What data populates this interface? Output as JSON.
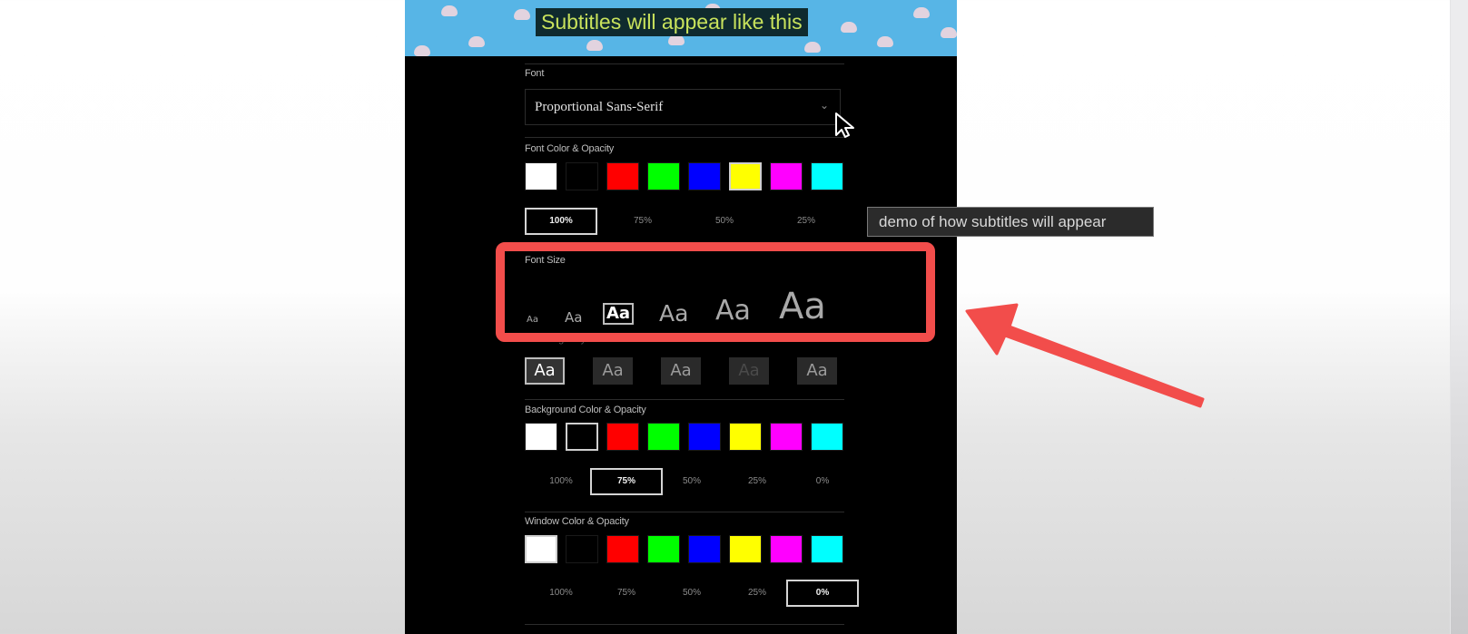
{
  "preview": {
    "subtitle_text": "Subtitles will appear like this",
    "background": "sky-with-clouds"
  },
  "font": {
    "label": "Font",
    "selected": "Proportional Sans-Serif",
    "chevron_icon": "chevron-down-icon"
  },
  "font_color": {
    "label": "Font Color & Opacity",
    "swatches": [
      "#ffffff",
      "#000000",
      "#ff0000",
      "#00ff00",
      "#0000ff",
      "#ffff00",
      "#ff00ff",
      "#00ffff"
    ],
    "selected_swatch": "#ffff00",
    "opacity_options": [
      "100%",
      "75%",
      "50%",
      "25%"
    ],
    "selected_opacity": "100%"
  },
  "font_size": {
    "label": "Font Size",
    "options": [
      "Aa",
      "Aa",
      "Aa",
      "Aa",
      "Aa",
      "Aa"
    ],
    "selected_index": 2
  },
  "font_edge": {
    "label": "Font Edge Style",
    "options": [
      "Aa",
      "Aa",
      "Aa",
      "Aa",
      "Aa"
    ],
    "selected_index": 0
  },
  "background_color": {
    "label": "Background Color & Opacity",
    "swatches": [
      "#ffffff",
      "#000000",
      "#ff0000",
      "#00ff00",
      "#0000ff",
      "#ffff00",
      "#ff00ff",
      "#00ffff"
    ],
    "selected_swatch": "#000000",
    "opacity_options": [
      "100%",
      "75%",
      "50%",
      "25%",
      "0%"
    ],
    "selected_opacity": "75%"
  },
  "window_color": {
    "label": "Window Color & Opacity",
    "swatches": [
      "#ffffff",
      "#000000",
      "#ff0000",
      "#00ff00",
      "#0000ff",
      "#ffff00",
      "#ff00ff",
      "#00ffff"
    ],
    "selected_swatch": "#ffffff",
    "opacity_options": [
      "100%",
      "75%",
      "50%",
      "25%",
      "0%"
    ],
    "selected_opacity": "0%"
  },
  "tooltip": {
    "text": "demo of how subtitles will appear"
  },
  "annotation": {
    "highlight_color": "#f24d4b",
    "highlight_target": "Font Size",
    "arrow_icon": "red-arrow-icon"
  }
}
